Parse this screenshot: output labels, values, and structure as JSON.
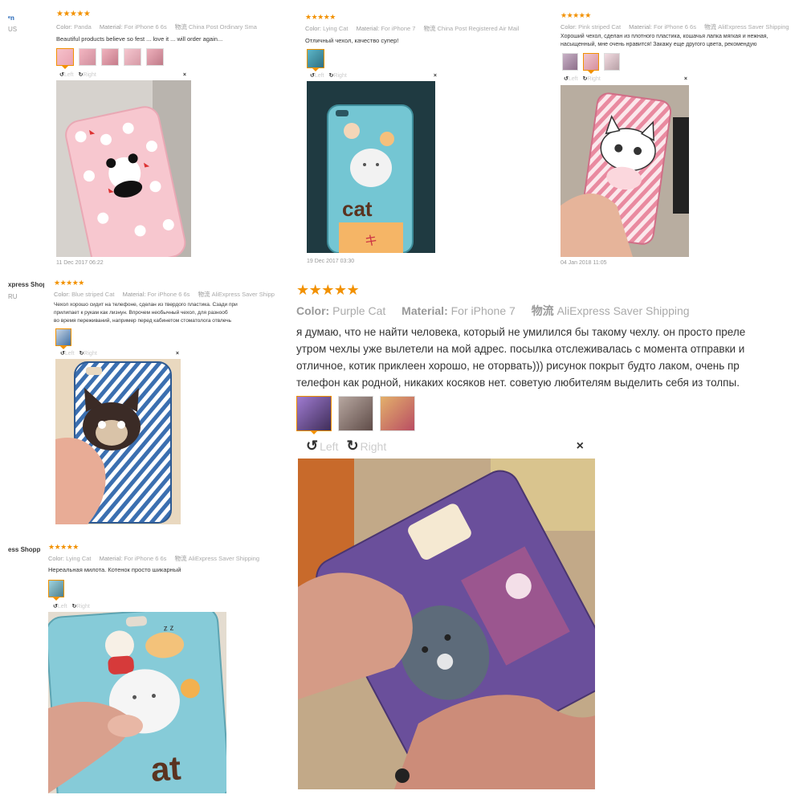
{
  "colors": {
    "star": "#f29100",
    "label": "#999999",
    "text": "#333333",
    "border": "#dddddd"
  },
  "stars": "★★★★★",
  "fragments": {
    "top_left_flag": "ᵉn",
    "top_left_country": "US",
    "mid_left_shopper": "xpress Shopper",
    "mid_left_country": "RU",
    "bottom_left_shopper": "ess Shopper"
  },
  "toolbar": {
    "left": "Left",
    "right": "Right",
    "close": "×"
  },
  "reviews": [
    {
      "color_label": "Color:",
      "color": "Panda",
      "material_label": "Material:",
      "material": "For iPhone 6 6s",
      "shipping_label": "物流",
      "shipping": "China Post Ordinary Small",
      "lines": [
        "Beautiful products believe so fest ... love it ... will order again..."
      ],
      "date": "11 Dec 2017 06:22"
    },
    {
      "color_label": "Color:",
      "color": "Lying Cat",
      "material_label": "Material:",
      "material": "For iPhone 7",
      "shipping_label": "物流",
      "shipping": "China Post Registered Air Mail",
      "lines": [
        "Отличный чехол, качество супер!"
      ],
      "date": "19 Dec 2017 03:30"
    },
    {
      "color_label": "Color:",
      "color": "Pink striped Cat",
      "material_label": "Material:",
      "material": "For iPhone 6 6s",
      "shipping_label": "物流",
      "shipping": "AliExpress Saver Shipping",
      "lines": [
        "Хороший чехол, сделан из плотного пластика, кошачья лапка мягкая и нежная,",
        "насыщенный, мне очень нравится! Закажу еще другого цвета, рекомендую"
      ],
      "date": "04 Jan 2018 11:05"
    },
    {
      "color_label": "Color:",
      "color": "Blue striped Cat",
      "material_label": "Material:",
      "material": "For iPhone 6 6s",
      "shipping_label": "物流",
      "shipping": "AliExpress Saver Shipp",
      "lines": [
        "Чехол хорошо сидит на телефоне, сделан из твердого пластика. Сзади при",
        "прилипает к рукам как лизнун. Впрочем необычный чехол, для разнооб",
        "во время переживаний, например перед кабинетом стоматолога отвлечь"
      ]
    },
    {
      "color_label": "Color:",
      "color": "Purple Cat",
      "material_label": "Material:",
      "material": "For iPhone 7",
      "shipping_label": "物流",
      "shipping": "AliExpress Saver Shipping",
      "lines": [
        "я думаю, что не найти человека, который не умилился бы такому чехлу. он просто преле",
        "утром чехлы уже вылетели на мой адрес. посылка отслеживалась с момента отправки и",
        "отличное, котик приклеен хорошо, не оторвать))) рисунок покрыт будто лаком, очень пр",
        "телефон как родной, никаких косяков нет. советую любителям выделить себя из толпы."
      ]
    },
    {
      "color_label": "Color:",
      "color": "Lying Cat",
      "material_label": "Material:",
      "material": "For iPhone 6 6s",
      "shipping_label": "物流",
      "shipping": "AliExpress Saver Shipping",
      "lines": [
        "Нереальная милота. Котенок просто шикарный"
      ]
    }
  ],
  "photo_text": {
    "cat_word": "cat",
    "cat_char": "キ",
    "at_word": "at",
    "zz": "z z"
  }
}
